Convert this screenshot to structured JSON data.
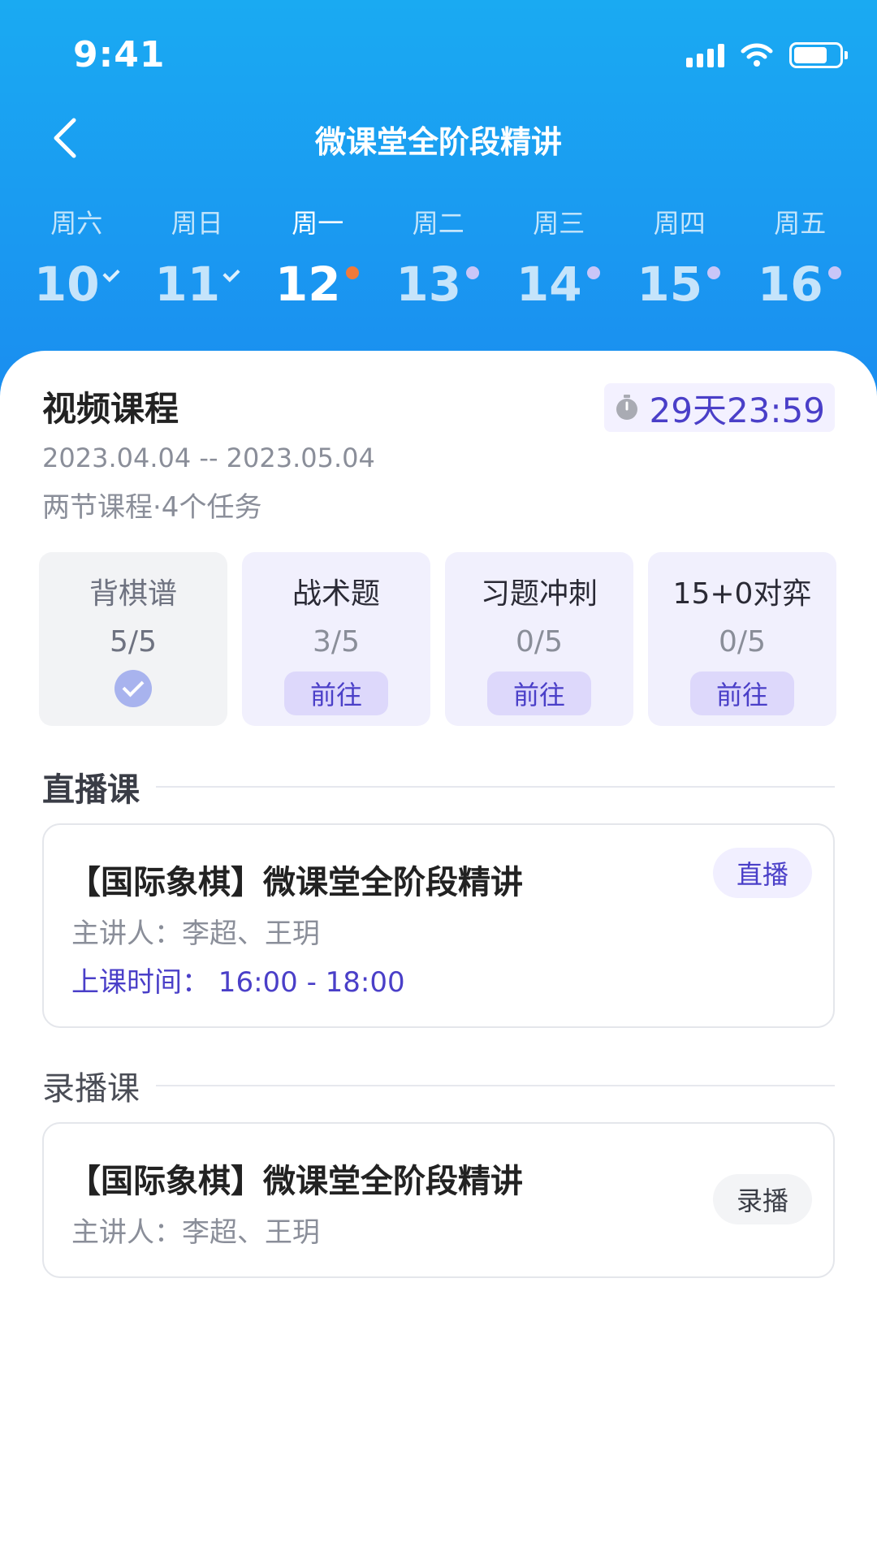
{
  "status_bar": {
    "time": "9:41"
  },
  "nav": {
    "title": "微课堂全阶段精讲"
  },
  "week": [
    {
      "name": "周六",
      "date": "10",
      "status": "done"
    },
    {
      "name": "周日",
      "date": "11",
      "status": "done"
    },
    {
      "name": "周一",
      "date": "12",
      "status": "today"
    },
    {
      "name": "周二",
      "date": "13",
      "status": "upcoming"
    },
    {
      "name": "周三",
      "date": "14",
      "status": "upcoming"
    },
    {
      "name": "周四",
      "date": "15",
      "status": "upcoming"
    },
    {
      "name": "周五",
      "date": "16",
      "status": "upcoming"
    }
  ],
  "video_course": {
    "title": "视频课程",
    "dates": "2023.04.04 -- 2023.05.04",
    "meta": "两节课程·4个任务",
    "countdown": "29天23:59"
  },
  "tasks": [
    {
      "name": "背棋谱",
      "progress": "5/5",
      "completed": true
    },
    {
      "name": "战术题",
      "progress": "3/5",
      "action": "前往"
    },
    {
      "name": "习题冲刺",
      "progress": "0/5",
      "action": "前往"
    },
    {
      "name": "15+0对弈",
      "progress": "0/5",
      "action": "前往"
    }
  ],
  "live_section": {
    "title": "直播课",
    "course": {
      "title": "【国际象棋】微课堂全阶段精讲",
      "teacher": "主讲人：李超、王玥",
      "time": "上课时间：  16:00 - 18:00",
      "tag": "直播"
    }
  },
  "recorded_section": {
    "title": "录播课",
    "course": {
      "title": "【国际象棋】微课堂全阶段精讲",
      "teacher": "主讲人：李超、王玥",
      "tag": "录播"
    }
  },
  "colors": {
    "header_top": "#1aaaf2",
    "header_bottom": "#1a8cf0",
    "accent": "#4a3fc8",
    "today_dot": "#f07a3a",
    "upcoming_dot": "#c9c6f8"
  }
}
